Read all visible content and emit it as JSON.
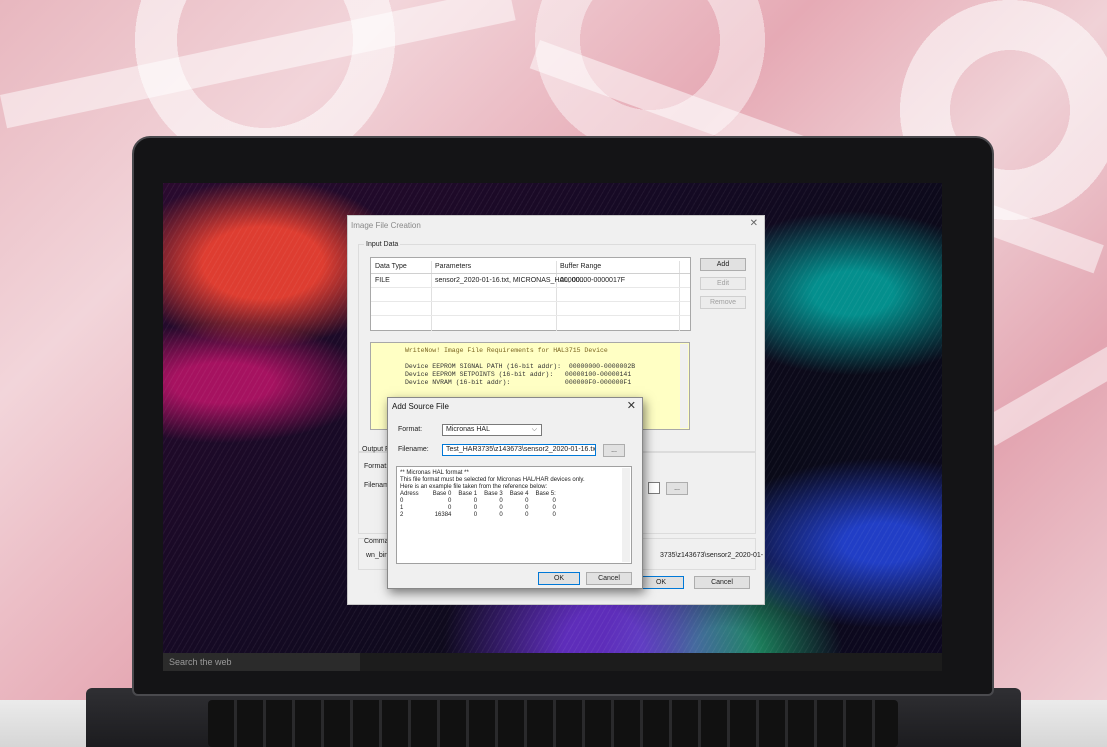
{
  "taskbar": {
    "search_placeholder": "Search the web"
  },
  "main_dialog": {
    "title": "Image File Creation",
    "close_glyph": "✕",
    "input_group_label": "Input Data",
    "table": {
      "headers": [
        "Data Type",
        "Parameters",
        "Buffer Range"
      ],
      "rows": [
        [
          "FILE",
          "sensor2_2020-01-16.txt, MICRONAS_HAL, 00...",
          "00000000-0000017F"
        ]
      ]
    },
    "buttons": {
      "add": "Add",
      "edit": "Edit",
      "remove": "Remove",
      "ok": "OK",
      "cancel": "Cancel",
      "browse": "..."
    },
    "notes": {
      "title": "WriteNow! Image File Requirements for HAL3715 Device",
      "lines": [
        "Device EEPROM SIGNAL PATH (16-bit addr):  00000000-0000002B",
        "Device EEPROM SETPOINTS (16-bit addr):   00000100-00000141",
        "Device NVRAM (16-bit addr):              000000F0-000000F1"
      ]
    },
    "output_group_label": "Output F",
    "format_label": "Format:",
    "filename_label": "Filenam",
    "command_group_label": "Comman",
    "command_prefix": "wn_bin",
    "command_suffix": "3735\\z143673\\sensor2_2020-01-"
  },
  "sub_dialog": {
    "title": "Add Source File",
    "close_glyph": "✕",
    "format_label": "Format:",
    "format_value": "Micronas HAL",
    "filename_label": "Filename:",
    "filename_value": "Test_HAR3735\\z143673\\sensor2_2020-01-16.txt",
    "browse_label": "...",
    "reference": {
      "heading": "** Micronas HAL format **",
      "line1": "This file format must be selected for Micronas HAL/HAR devices only.",
      "line2": "Here is an example file taken from the reference below:",
      "columns": [
        "Adress",
        "Base 0",
        "Base 1",
        "Base 3",
        "Base 4",
        "Base 5:"
      ],
      "rows": [
        [
          "0",
          "0",
          "0",
          "0",
          "0",
          "0"
        ],
        [
          "1",
          "0",
          "0",
          "0",
          "0",
          "0"
        ],
        [
          "2",
          "16384",
          "0",
          "0",
          "0",
          "0"
        ]
      ]
    },
    "ok_label": "OK",
    "cancel_label": "Cancel"
  }
}
